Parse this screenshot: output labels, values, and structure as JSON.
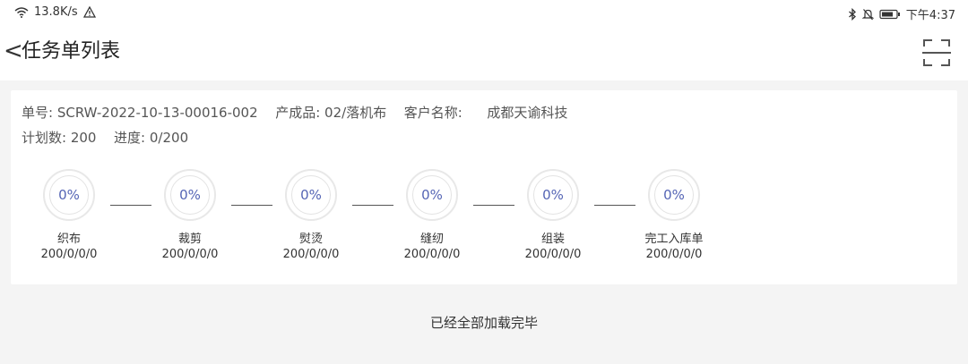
{
  "status_bar": {
    "network_speed": "13.8K/s",
    "time": "下午4:37",
    "icons": [
      "wifi-icon",
      "warning-icon",
      "bluetooth-icon",
      "mute-icon",
      "battery-icon"
    ]
  },
  "header": {
    "back_label": "<",
    "title": "任务单列表",
    "scan_icon": "scan-icon"
  },
  "task": {
    "order_no_label": "单号:",
    "order_no": "SCRW-2022-10-13-00016-002",
    "product_label": "产成品:",
    "product": "02/落机布",
    "customer_label": "客户名称:",
    "customer": "成都天谕科技",
    "plan_label": "计划数:",
    "plan": "200",
    "progress_label": "进度:",
    "progress": "0/200",
    "steps": [
      {
        "percent": "0%",
        "name": "织布",
        "count": "200/0/0/0"
      },
      {
        "percent": "0%",
        "name": "裁剪",
        "count": "200/0/0/0"
      },
      {
        "percent": "0%",
        "name": "熨烫",
        "count": "200/0/0/0"
      },
      {
        "percent": "0%",
        "name": "缝纫",
        "count": "200/0/0/0"
      },
      {
        "percent": "0%",
        "name": "组装",
        "count": "200/0/0/0"
      },
      {
        "percent": "0%",
        "name": "完工入库单",
        "count": "200/0/0/0"
      }
    ]
  },
  "footer": {
    "text": "已经全部加载完毕"
  },
  "colors": {
    "accent": "#5565b5",
    "background": "#f4f4f4",
    "card": "#ffffff"
  }
}
